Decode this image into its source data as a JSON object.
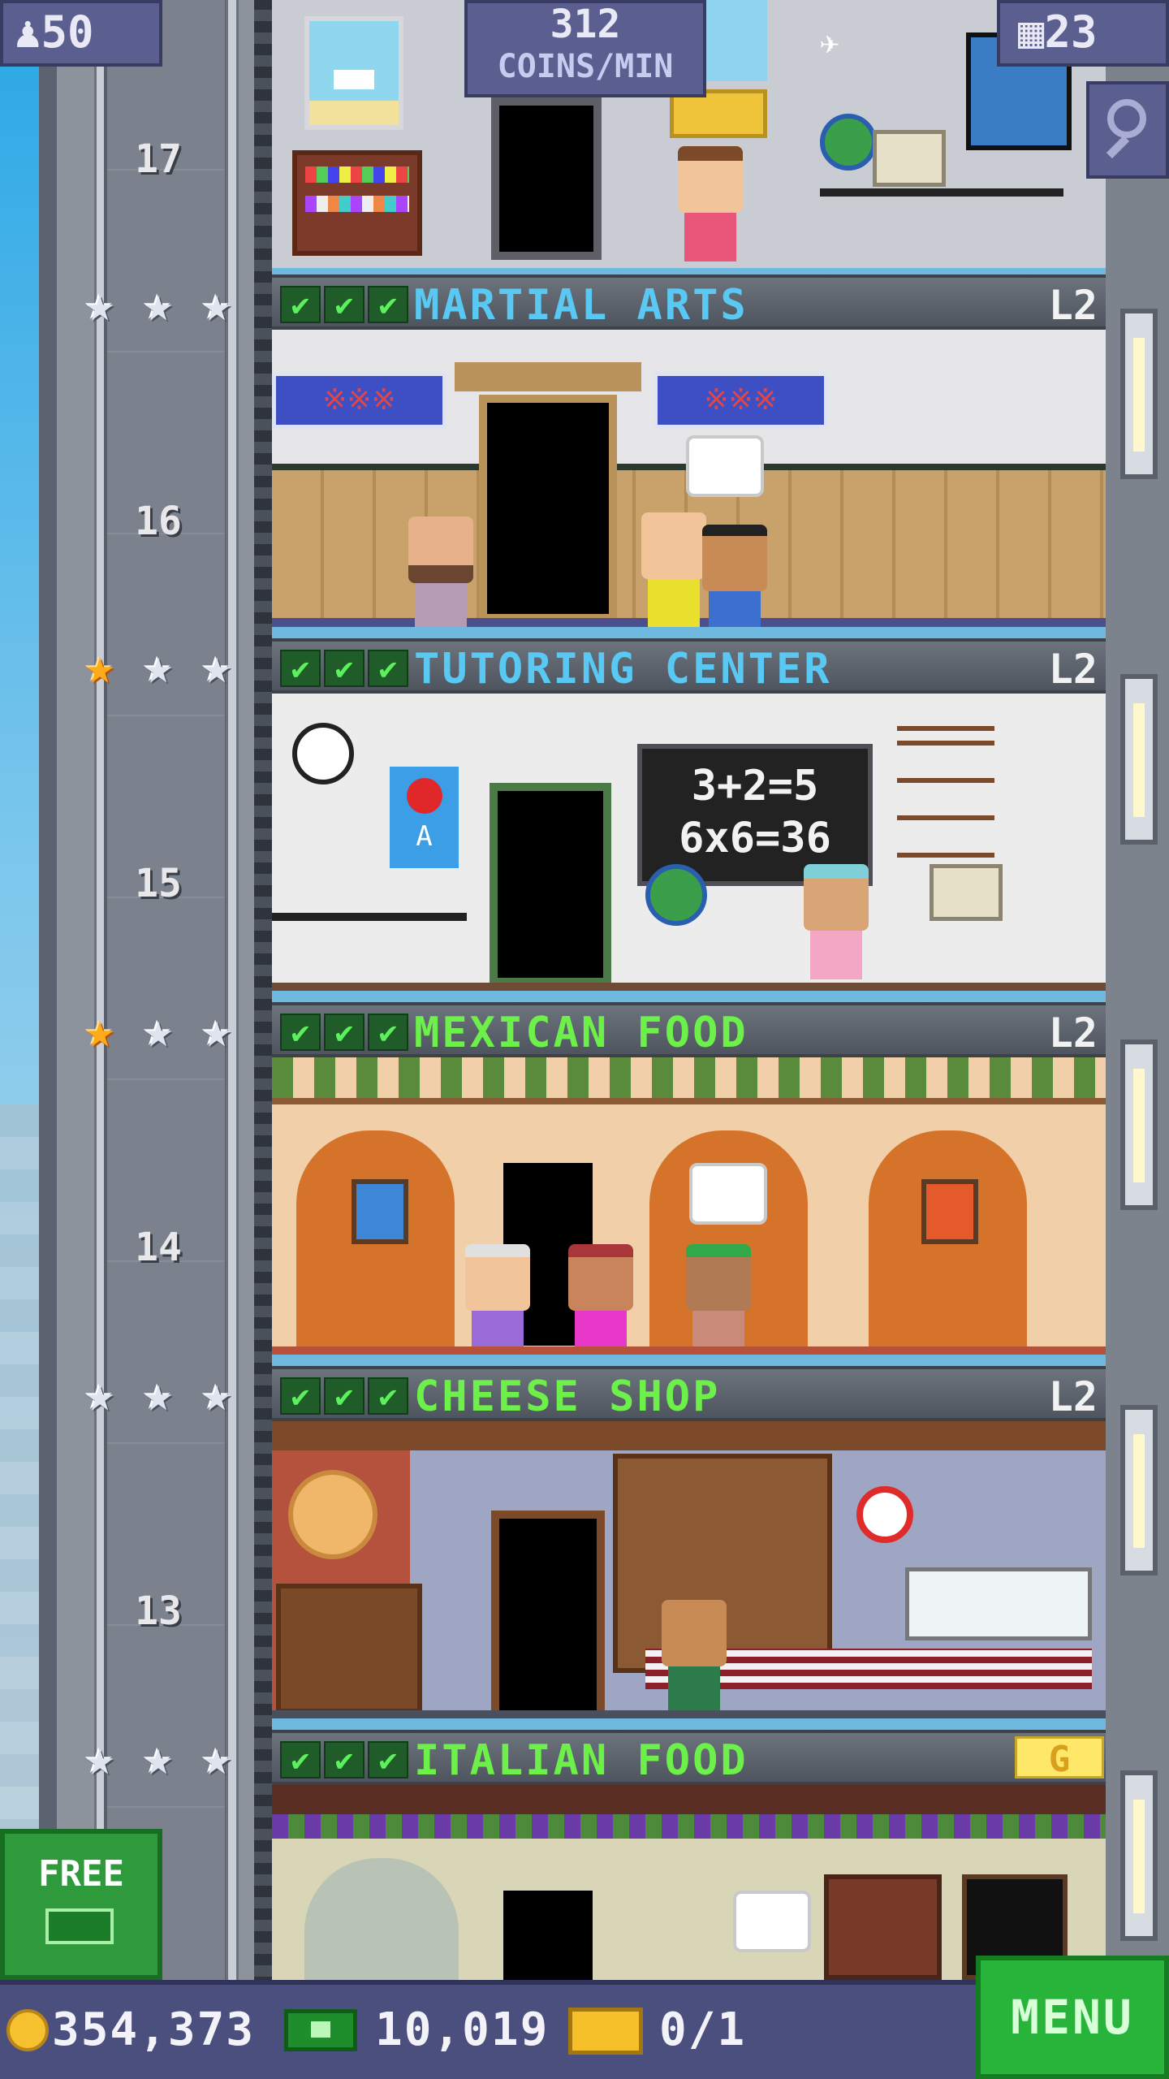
{
  "hud": {
    "population": "50",
    "coins_rate_value": "312",
    "coins_rate_unit": "COINS/MIN",
    "floors": "23"
  },
  "bottom_bar": {
    "coins": "354,373",
    "bux": "10,019",
    "tickets": "0/1",
    "menu_label": "MENU"
  },
  "free_button": {
    "label": "FREE"
  },
  "floors": [
    {
      "number": "17"
    },
    {
      "number": "16",
      "name": "MARTIAL ARTS",
      "level": "L2",
      "stars": 0,
      "name_color": "#59c8f2"
    },
    {
      "number": "15",
      "name": "TUTORING CENTER",
      "level": "L2",
      "stars": 1,
      "name_color": "#59c8f2"
    },
    {
      "number": "14",
      "name": "MEXICAN FOOD",
      "level": "L2",
      "stars": 1,
      "name_color": "#6ef04a"
    },
    {
      "number": "13",
      "name": "CHEESE SHOP",
      "level": "L2",
      "stars": 0,
      "name_color": "#6ef04a"
    },
    {
      "number": "12",
      "name": "ITALIAN FOOD",
      "badge": "G",
      "stars": 0,
      "name_color": "#6ef04a"
    }
  ],
  "chalkboard": {
    "line1": "3+2=5",
    "line2": "6x6=36"
  },
  "poster_letter": "A",
  "colors": {
    "hud_bg": "#5a5f8f",
    "menu_green": "#28b43a",
    "gold_star": "#ffaa1a"
  }
}
